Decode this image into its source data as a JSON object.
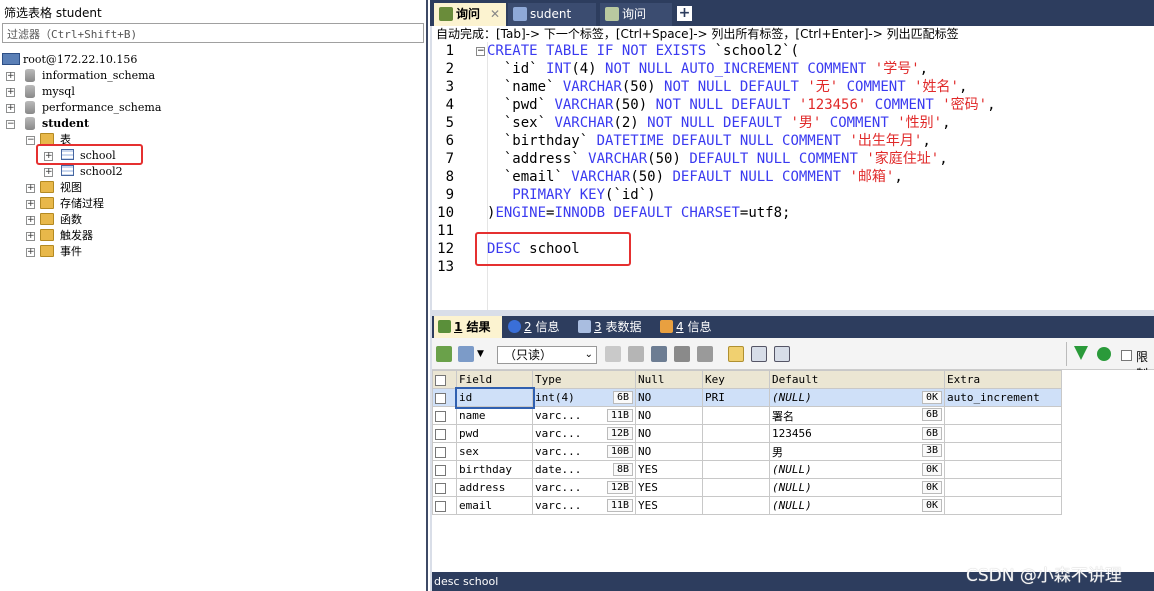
{
  "left_panel": {
    "title": "筛选表格 student",
    "filter_placeholder": "过滤器（Ctrl+Shift+B)",
    "connection": "root@172.22.10.156",
    "databases": [
      "information_schema",
      "mysql",
      "performance_schema",
      "student"
    ],
    "student_children": {
      "tables_folder": "表",
      "tables": [
        "school",
        "school2"
      ],
      "folders": [
        "视图",
        "存储过程",
        "函数",
        "触发器",
        "事件"
      ]
    }
  },
  "tabs": [
    {
      "label": "询问",
      "active": true
    },
    {
      "label": "sudent",
      "active": false
    },
    {
      "label": "询问",
      "active": false
    }
  ],
  "hint": "自动完成：[Tab]-> 下一个标签，[Ctrl+Space]-> 列出所有标签，[Ctrl+Enter]-> 列出匹配标签",
  "editor": {
    "line_numbers": [
      "1",
      "2",
      "3",
      "4",
      "5",
      "6",
      "7",
      "8",
      "9",
      "10",
      "11",
      "12",
      "13"
    ],
    "lines": [
      [
        {
          "t": "CREATE TABLE IF NOT EXISTS",
          "c": "kw"
        },
        {
          "t": " `school2`(",
          "c": ""
        }
      ],
      [
        {
          "t": "  `id` ",
          "c": ""
        },
        {
          "t": "INT",
          "c": "kw"
        },
        {
          "t": "(4) ",
          "c": ""
        },
        {
          "t": "NOT NULL AUTO_INCREMENT COMMENT",
          "c": "kw"
        },
        {
          "t": " ",
          "c": ""
        },
        {
          "t": "'学号'",
          "c": "str"
        },
        {
          "t": ",",
          "c": ""
        }
      ],
      [
        {
          "t": "  `name` ",
          "c": ""
        },
        {
          "t": "VARCHAR",
          "c": "kw"
        },
        {
          "t": "(50) ",
          "c": ""
        },
        {
          "t": "NOT NULL DEFAULT",
          "c": "kw"
        },
        {
          "t": " ",
          "c": ""
        },
        {
          "t": "'无'",
          "c": "str"
        },
        {
          "t": " ",
          "c": ""
        },
        {
          "t": "COMMENT",
          "c": "kw"
        },
        {
          "t": " ",
          "c": ""
        },
        {
          "t": "'姓名'",
          "c": "str"
        },
        {
          "t": ",",
          "c": ""
        }
      ],
      [
        {
          "t": "  `pwd` ",
          "c": ""
        },
        {
          "t": "VARCHAR",
          "c": "kw"
        },
        {
          "t": "(50) ",
          "c": ""
        },
        {
          "t": "NOT NULL DEFAULT",
          "c": "kw"
        },
        {
          "t": " ",
          "c": ""
        },
        {
          "t": "'123456'",
          "c": "str"
        },
        {
          "t": " ",
          "c": ""
        },
        {
          "t": "COMMENT",
          "c": "kw"
        },
        {
          "t": " ",
          "c": ""
        },
        {
          "t": "'密码'",
          "c": "str"
        },
        {
          "t": ",",
          "c": ""
        }
      ],
      [
        {
          "t": "  `sex` ",
          "c": ""
        },
        {
          "t": "VARCHAR",
          "c": "kw"
        },
        {
          "t": "(2) ",
          "c": ""
        },
        {
          "t": "NOT NULL DEFAULT",
          "c": "kw"
        },
        {
          "t": " ",
          "c": ""
        },
        {
          "t": "'男'",
          "c": "str"
        },
        {
          "t": " ",
          "c": ""
        },
        {
          "t": "COMMENT",
          "c": "kw"
        },
        {
          "t": " ",
          "c": ""
        },
        {
          "t": "'性别'",
          "c": "str"
        },
        {
          "t": ",",
          "c": ""
        }
      ],
      [
        {
          "t": "  `birthday` ",
          "c": ""
        },
        {
          "t": "DATETIME DEFAULT NULL COMMENT",
          "c": "kw"
        },
        {
          "t": " ",
          "c": ""
        },
        {
          "t": "'出生年月'",
          "c": "str"
        },
        {
          "t": ",",
          "c": ""
        }
      ],
      [
        {
          "t": "  `address` ",
          "c": ""
        },
        {
          "t": "VARCHAR",
          "c": "kw"
        },
        {
          "t": "(50) ",
          "c": ""
        },
        {
          "t": "DEFAULT NULL COMMENT",
          "c": "kw"
        },
        {
          "t": " ",
          "c": ""
        },
        {
          "t": "'家庭住址'",
          "c": "str"
        },
        {
          "t": ",",
          "c": ""
        }
      ],
      [
        {
          "t": "  `email` ",
          "c": ""
        },
        {
          "t": "VARCHAR",
          "c": "kw"
        },
        {
          "t": "(50) ",
          "c": ""
        },
        {
          "t": "DEFAULT NULL COMMENT",
          "c": "kw"
        },
        {
          "t": " ",
          "c": ""
        },
        {
          "t": "'邮箱'",
          "c": "str"
        },
        {
          "t": ",",
          "c": ""
        }
      ],
      [
        {
          "t": "   ",
          "c": ""
        },
        {
          "t": "PRIMARY KEY",
          "c": "kw"
        },
        {
          "t": "(`id`)",
          "c": ""
        }
      ],
      [
        {
          "t": ")",
          "c": ""
        },
        {
          "t": "ENGINE",
          "c": "kw"
        },
        {
          "t": "=",
          "c": ""
        },
        {
          "t": "INNODB DEFAULT CHARSET",
          "c": "kw"
        },
        {
          "t": "=utf8;",
          "c": ""
        }
      ],
      [],
      [
        {
          "t": "DESC",
          "c": "kw"
        },
        {
          "t": " school",
          "c": ""
        }
      ],
      []
    ]
  },
  "result_tabs": [
    {
      "num": "1",
      "label": "结果",
      "active": true
    },
    {
      "num": "2",
      "label": "信息",
      "active": false
    },
    {
      "num": "3",
      "label": "表数据",
      "active": false
    },
    {
      "num": "4",
      "label": "信息",
      "active": false
    }
  ],
  "toolbar": {
    "readonly_select": "（只读）",
    "limit_label": "限制"
  },
  "grid": {
    "headers": [
      "Field",
      "Type",
      "Null",
      "Key",
      "Default",
      "Extra"
    ],
    "rows": [
      {
        "field": "id",
        "type": "int(4)",
        "type_size": "6B",
        "null": "NO",
        "key": "PRI",
        "default": "(NULL)",
        "default_size": "0K",
        "extra": "auto_increment",
        "selected": true,
        "default_null": true
      },
      {
        "field": "name",
        "type": "varc...",
        "type_size": "11B",
        "null": "NO",
        "key": "",
        "default": "署名",
        "default_size": "6B",
        "extra": "",
        "selected": false,
        "default_null": false
      },
      {
        "field": "pwd",
        "type": "varc...",
        "type_size": "12B",
        "null": "NO",
        "key": "",
        "default": "123456",
        "default_size": "6B",
        "extra": "",
        "selected": false,
        "default_null": false
      },
      {
        "field": "sex",
        "type": "varc...",
        "type_size": "10B",
        "null": "NO",
        "key": "",
        "default": "男",
        "default_size": "3B",
        "extra": "",
        "selected": false,
        "default_null": false
      },
      {
        "field": "birthday",
        "type": "date...",
        "type_size": "8B",
        "null": "YES",
        "key": "",
        "default": "(NULL)",
        "default_size": "0K",
        "extra": "",
        "selected": false,
        "default_null": true
      },
      {
        "field": "address",
        "type": "varc...",
        "type_size": "12B",
        "null": "YES",
        "key": "",
        "default": "(NULL)",
        "default_size": "0K",
        "extra": "",
        "selected": false,
        "default_null": true
      },
      {
        "field": "email",
        "type": "varc...",
        "type_size": "11B",
        "null": "YES",
        "key": "",
        "default": "(NULL)",
        "default_size": "0K",
        "extra": "",
        "selected": false,
        "default_null": true
      }
    ]
  },
  "status": "desc school",
  "watermark": "CSDN @小森不讲理"
}
